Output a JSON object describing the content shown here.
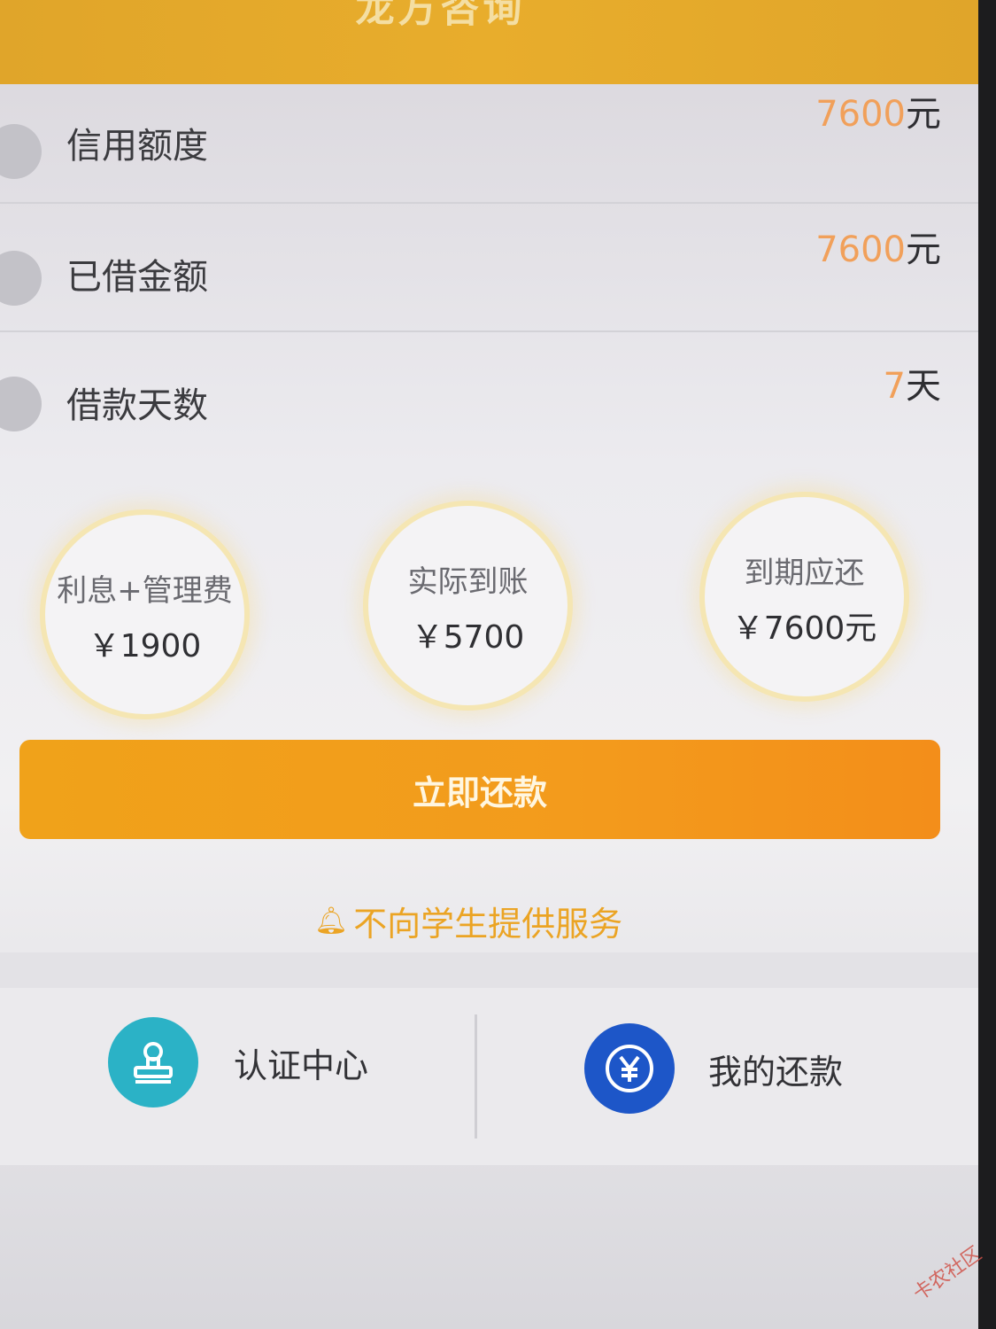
{
  "header": {
    "title": "龙方咨询"
  },
  "rows": [
    {
      "label": "信用额度",
      "value_num": "7600",
      "value_unit": "元"
    },
    {
      "label": "已借金额",
      "value_num": "7600",
      "value_unit": "元"
    },
    {
      "label": "借款天数",
      "value_num": "7",
      "value_unit": "天"
    }
  ],
  "circles": [
    {
      "title": "利息+管理费",
      "value": "￥1900"
    },
    {
      "title": "实际到账",
      "value": "￥5700"
    },
    {
      "title": "到期应还",
      "value": "￥7600元"
    }
  ],
  "repay_button": {
    "label": "立即还款"
  },
  "notice": {
    "text": "不向学生提供服务",
    "icon": "bell-icon"
  },
  "actions": [
    {
      "label": "认证中心",
      "icon": "stamp-icon",
      "color": "#2bb2c6"
    },
    {
      "label": "我的还款",
      "icon": "yen-icon",
      "color": "#1d56c8"
    }
  ],
  "watermark": {
    "text": "卡农社区"
  },
  "colors": {
    "accent": "#f39b1c",
    "header": "#e8ad2c",
    "value_highlight": "#f1a05a"
  }
}
